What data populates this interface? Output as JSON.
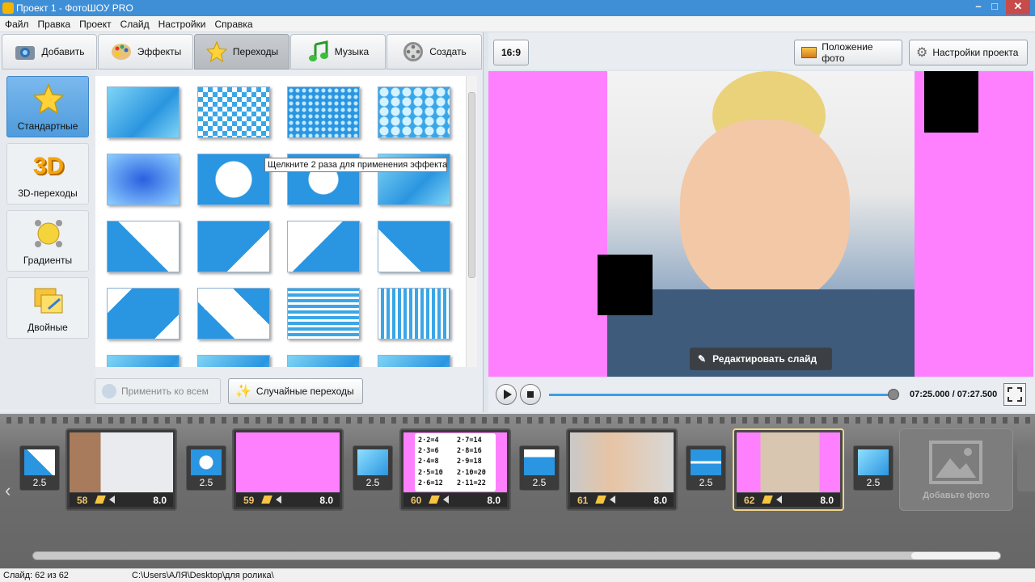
{
  "window": {
    "title": "Проект 1 - ФотоШОУ PRO"
  },
  "menu": [
    "Файл",
    "Правка",
    "Проект",
    "Слайд",
    "Настройки",
    "Справка"
  ],
  "tabs": [
    {
      "label": "Добавить",
      "icon": "camera-icon"
    },
    {
      "label": "Эффекты",
      "icon": "palette-icon"
    },
    {
      "label": "Переходы",
      "icon": "star-icon",
      "active": true
    },
    {
      "label": "Музыка",
      "icon": "music-note-icon"
    },
    {
      "label": "Создать",
      "icon": "film-reel-icon"
    }
  ],
  "categories": [
    {
      "label": "Стандартные",
      "active": true,
      "icon": "star-icon"
    },
    {
      "label": "3D-переходы",
      "icon": "3d-text-icon",
      "icon_text": "3D"
    },
    {
      "label": "Градиенты",
      "icon": "gradient-icon"
    },
    {
      "label": "Двойные",
      "icon": "double-frame-icon"
    }
  ],
  "tooltip": "Щелкните 2 раза для применения эффекта",
  "buttons": {
    "apply_all": "Применить ко всем",
    "random": "Случайные переходы",
    "aspect": "16:9",
    "photo_position": "Положение фото",
    "project_settings": "Настройки проекта",
    "edit_slide": "Редактировать слайд",
    "add_photo": "Добавьте фото"
  },
  "player": {
    "time": "07:25.000 / 07:27.500",
    "progress": 0.99
  },
  "slides": [
    {
      "num": "58",
      "duration": "8.0"
    },
    {
      "num": "59",
      "duration": "8.0"
    },
    {
      "num": "60",
      "duration": "8.0"
    },
    {
      "num": "61",
      "duration": "8.0"
    },
    {
      "num": "62",
      "duration": "8.0",
      "selected": true
    }
  ],
  "transitions": [
    "2.5",
    "2.5",
    "2.5",
    "2.5",
    "2.5",
    "2.5"
  ],
  "math_card": [
    "2·2=4",
    "2·7=14",
    "2·3=6",
    "2·8=16",
    "2·4=8",
    "2·9=18",
    "2·5=10",
    "2·10=20",
    "2·6=12",
    "2·11=22"
  ],
  "status": {
    "slide": "Слайд: 62 из 62",
    "path": "C:\\Users\\АЛЯ\\Desktop\\для ролика\\"
  },
  "colors": {
    "accent": "#3f8fd6",
    "preview_bg": "#ff80ff",
    "selected_slide": "#f0d58a"
  }
}
